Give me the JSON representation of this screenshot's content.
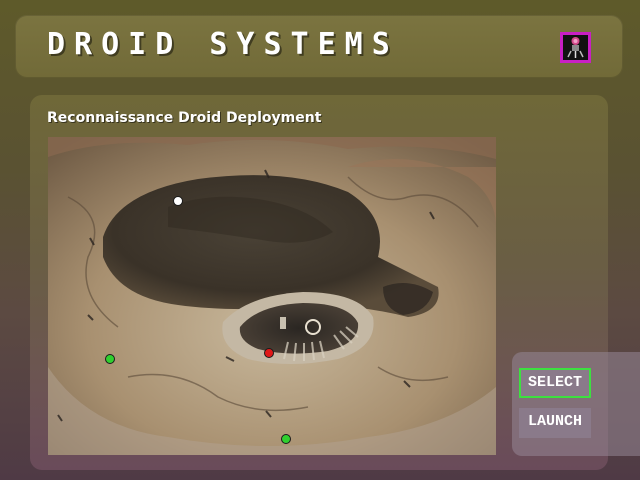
{
  "header": {
    "title": "DROID SYSTEMS",
    "icon": "droid-portrait-icon",
    "badge_border_color": "#c81fc4"
  },
  "panel": {
    "subtitle": "Reconnaissance Droid Deployment"
  },
  "map": {
    "markers": [
      {
        "name": "marker-white",
        "color": "#ffffff"
      },
      {
        "name": "marker-red",
        "color": "#e01818"
      },
      {
        "name": "marker-green-left",
        "color": "#2fd02f"
      },
      {
        "name": "marker-green-bottom",
        "color": "#2fd02f"
      }
    ]
  },
  "buttons": {
    "select_label": "SELECT",
    "launch_label": "LAUNCH",
    "selected_border_color": "#3de040"
  }
}
